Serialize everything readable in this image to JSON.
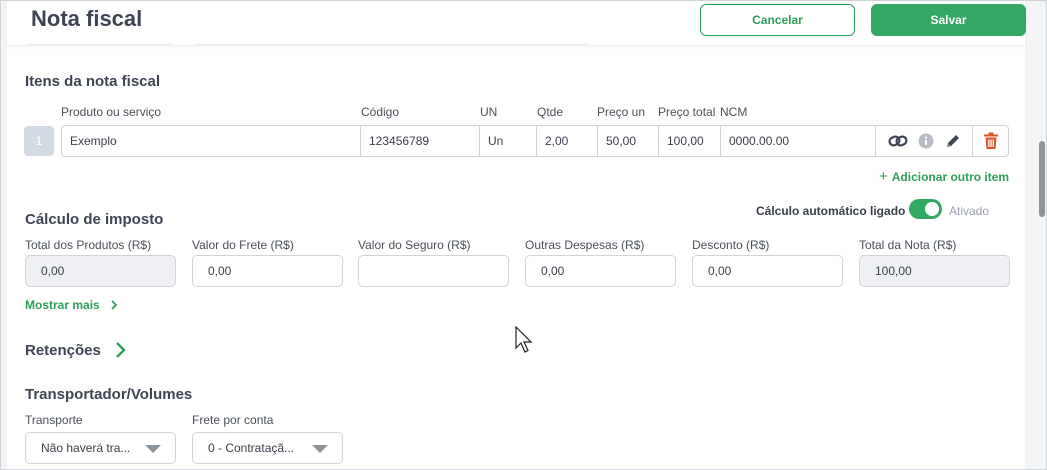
{
  "header": {
    "title": "Nota fiscal",
    "cancel_label": "Cancelar",
    "save_label": "Salvar"
  },
  "items_section": {
    "title": "Itens da nota fiscal",
    "columns": [
      "Produto ou serviço",
      "Código",
      "UN",
      "Qtde",
      "Preço un",
      "Preço total",
      "NCM"
    ],
    "rows": [
      {
        "index": "1",
        "product": "Exemplo",
        "code": "123456789",
        "unit": "Un",
        "qty": "2,00",
        "unit_price": "50,00",
        "total_price": "100,00",
        "ncm": "0000.00.00"
      }
    ],
    "add_item_label": "Adicionar outro item"
  },
  "tax_section": {
    "title": "Cálculo de imposto",
    "auto_calc_label": "Cálculo automático ligado",
    "auto_calc_state": "Ativado",
    "auto_calc_on": true,
    "fields": [
      {
        "label": "Total dos Produtos (R$)",
        "value": "0,00",
        "readonly": true
      },
      {
        "label": "Valor do Frete (R$)",
        "value": "0,00",
        "readonly": false
      },
      {
        "label": "Valor do Seguro (R$)",
        "value": "",
        "readonly": false
      },
      {
        "label": "Outras Despesas (R$)",
        "value": "0,00",
        "readonly": false
      },
      {
        "label": "Desconto (R$)",
        "value": "0,00",
        "readonly": false
      },
      {
        "label": "Total da Nota (R$)",
        "value": "100,00",
        "readonly": true
      }
    ],
    "show_more_label": "Mostrar mais"
  },
  "retencoes": {
    "title": "Retenções"
  },
  "transport": {
    "title": "Transportador/Volumes",
    "transporte_label": "Transporte",
    "transporte_value": "Não haverá tra...",
    "frete_label": "Frete por conta",
    "frete_value": "0 - Contrataçã..."
  },
  "colors": {
    "accent": "#33a863",
    "delete": "#d9542b",
    "text": "#3e4552"
  }
}
